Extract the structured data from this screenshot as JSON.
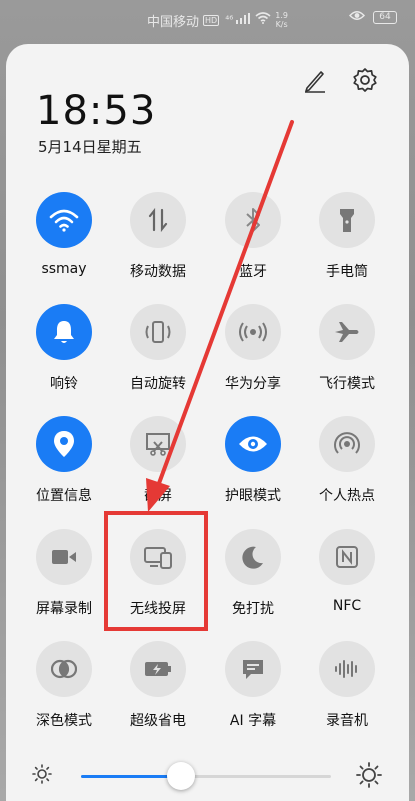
{
  "status_bar": {
    "carrier": "中国移动",
    "hd": "HD",
    "signal": "⁴⁶",
    "speed_top": "1.9",
    "speed_bottom": "K/s",
    "battery": "64"
  },
  "header": {
    "time": "18:53",
    "date": "5月14日星期五",
    "edit_icon": "pencil-icon",
    "settings_icon": "gear-icon"
  },
  "tiles": [
    {
      "label": "ssmay",
      "icon": "wifi-icon",
      "active": true
    },
    {
      "label": "移动数据",
      "icon": "mobile-data-icon",
      "active": false
    },
    {
      "label": "蓝牙",
      "icon": "bluetooth-icon",
      "active": false
    },
    {
      "label": "手电筒",
      "icon": "flashlight-icon",
      "active": false
    },
    {
      "label": "响铃",
      "icon": "bell-icon",
      "active": true
    },
    {
      "label": "自动旋转",
      "icon": "rotate-icon",
      "active": false
    },
    {
      "label": "华为分享",
      "icon": "share-icon",
      "active": false
    },
    {
      "label": "飞行模式",
      "icon": "airplane-icon",
      "active": false
    },
    {
      "label": "位置信息",
      "icon": "location-icon",
      "active": true
    },
    {
      "label": "截屏",
      "icon": "screenshot-icon",
      "active": false
    },
    {
      "label": "护眼模式",
      "icon": "eye-icon",
      "active": true
    },
    {
      "label": "个人热点",
      "icon": "hotspot-icon",
      "active": false
    },
    {
      "label": "屏幕录制",
      "icon": "screen-record-icon",
      "active": false
    },
    {
      "label": "无线投屏",
      "icon": "wireless-projection-icon",
      "active": false
    },
    {
      "label": "免打扰",
      "icon": "moon-icon",
      "active": false
    },
    {
      "label": "NFC",
      "icon": "nfc-icon",
      "active": false
    },
    {
      "label": "深色模式",
      "icon": "dark-mode-icon",
      "active": false
    },
    {
      "label": "超级省电",
      "icon": "battery-saver-icon",
      "active": false
    },
    {
      "label": "AI 字幕",
      "icon": "subtitle-icon",
      "active": false
    },
    {
      "label": "录音机",
      "icon": "recorder-icon",
      "active": false
    }
  ],
  "brightness": {
    "level": 0.4
  },
  "colors": {
    "accent": "#1a7cf5",
    "annotation": "#e53935"
  }
}
